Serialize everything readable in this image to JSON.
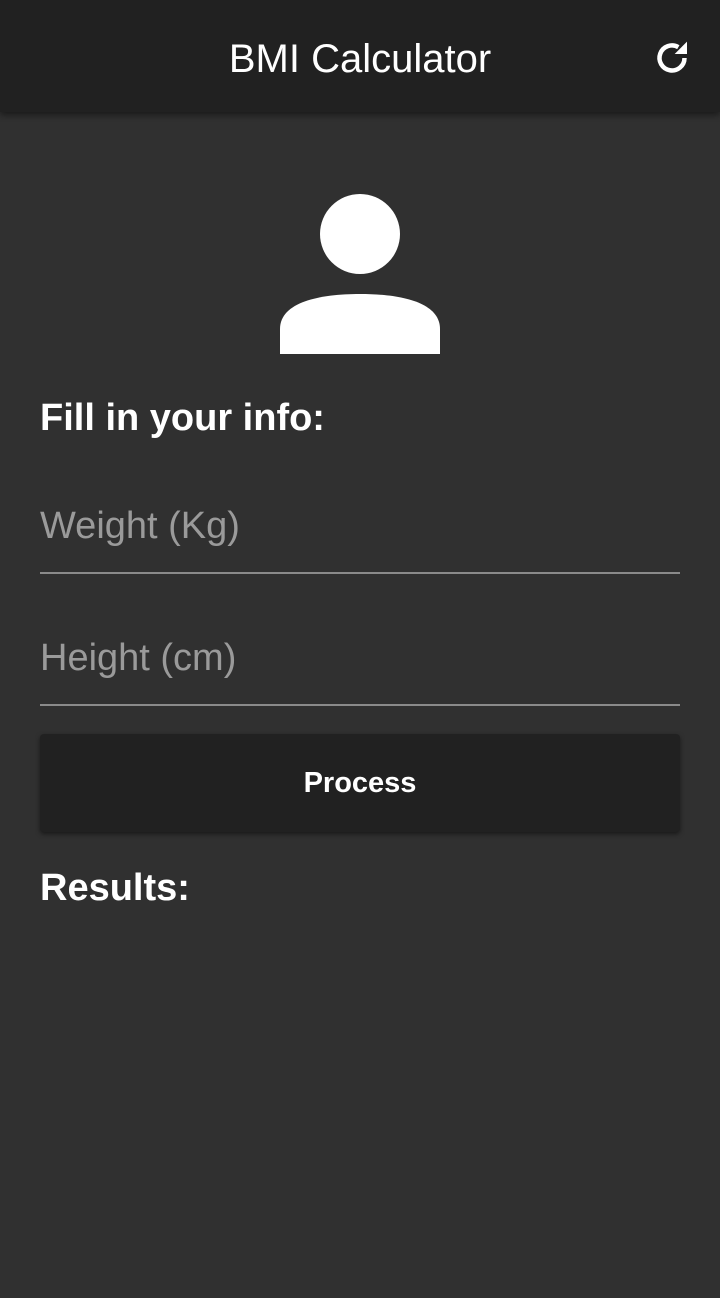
{
  "app_bar": {
    "title": "BMI Calculator",
    "refresh_icon": "refresh-icon"
  },
  "avatar": {
    "icon": "person-icon"
  },
  "form": {
    "heading": "Fill in your info:",
    "weight_placeholder": "Weight (Kg)",
    "weight_value": "",
    "height_placeholder": "Height (cm)",
    "height_value": "",
    "process_label": "Process"
  },
  "results": {
    "heading": "Results:"
  },
  "colors": {
    "background": "#303030",
    "app_bar": "#212121",
    "button": "#212121",
    "text": "#ffffff",
    "placeholder": "#9a9a9a",
    "underline": "#8a8a8a"
  }
}
